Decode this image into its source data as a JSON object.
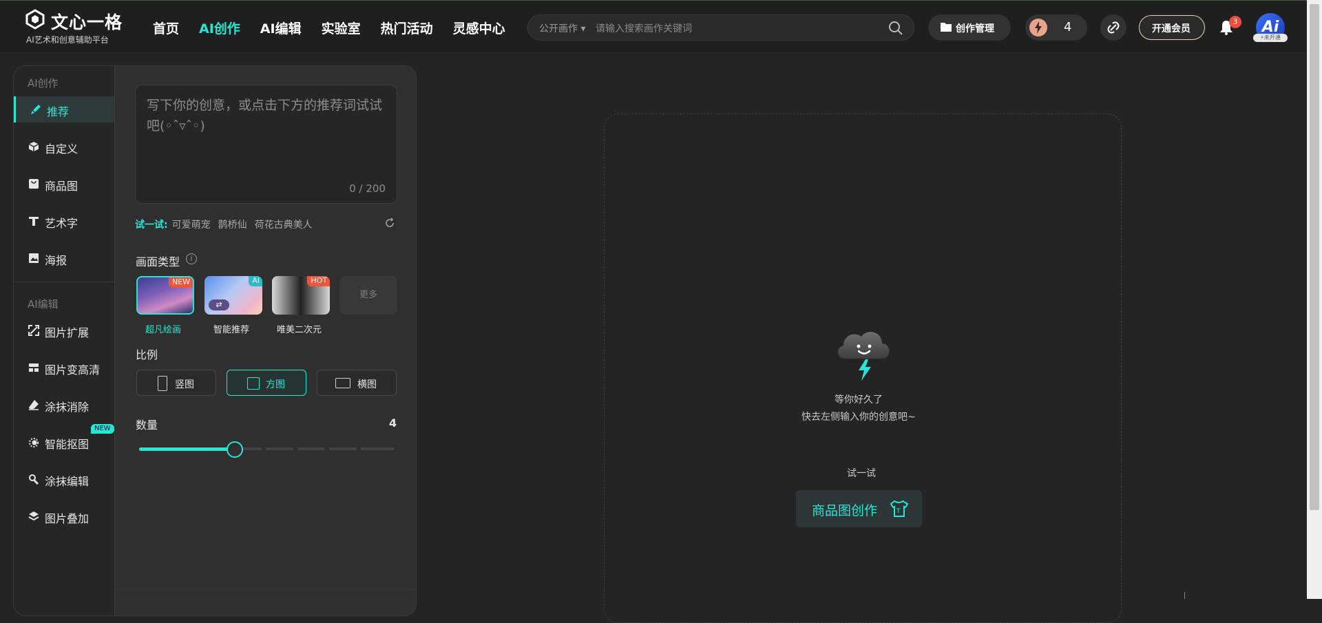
{
  "brand": {
    "name": "文心一格",
    "tagline": "AI艺术和创意辅助平台"
  },
  "nav": [
    "首页",
    "AI创作",
    "AI编辑",
    "实验室",
    "热门活动",
    "灵感中心"
  ],
  "search": {
    "scope": "公开画作",
    "placeholder": "请输入搜索画作关键词"
  },
  "header": {
    "manage_label": "创作管理",
    "energy_count": "4",
    "vip_label": "开通会员",
    "notification_count": "3",
    "avatar_text": "Ai",
    "avatar_tag": "未开通"
  },
  "sidebar": {
    "group1": "AI创作",
    "items1": [
      "推荐",
      "自定义",
      "商品图",
      "艺术字",
      "海报"
    ],
    "group2": "AI编辑",
    "items2": [
      "图片扩展",
      "图片变高清",
      "涂抹消除",
      "智能抠图",
      "涂抹编辑",
      "图片叠加"
    ],
    "new_tag": "NEW"
  },
  "prompt": {
    "placeholder": "写下你的创意，或点击下方的推荐词试试吧(◦ˆ▿ˆ◦)",
    "count": "0 / 200"
  },
  "suggestions": {
    "label": "试一试:",
    "items": [
      "可爱萌宠",
      "鹊桥仙",
      "荷花古典美人"
    ]
  },
  "picture_type": {
    "title": "画面类型",
    "options": [
      {
        "label": "超凡绘画",
        "tag": "NEW"
      },
      {
        "label": "智能推荐",
        "tag": "AI"
      },
      {
        "label": "唯美二次元",
        "tag": "HOT"
      }
    ],
    "more": "更多",
    "selected": "超凡绘画"
  },
  "ratio": {
    "title": "比例",
    "options": [
      "竖图",
      "方图",
      "横图"
    ],
    "selected": "方图"
  },
  "quantity": {
    "title": "数量",
    "value": "4",
    "fraction": 0.375
  },
  "canvas": {
    "line1": "等你好久了",
    "line2": "快去左侧输入你的创意吧~",
    "try_label": "试一试",
    "cta": "商品图创作"
  },
  "colors": {
    "accent": "#27e6d6",
    "background": "#242424",
    "panel": "#2f2f2f"
  }
}
